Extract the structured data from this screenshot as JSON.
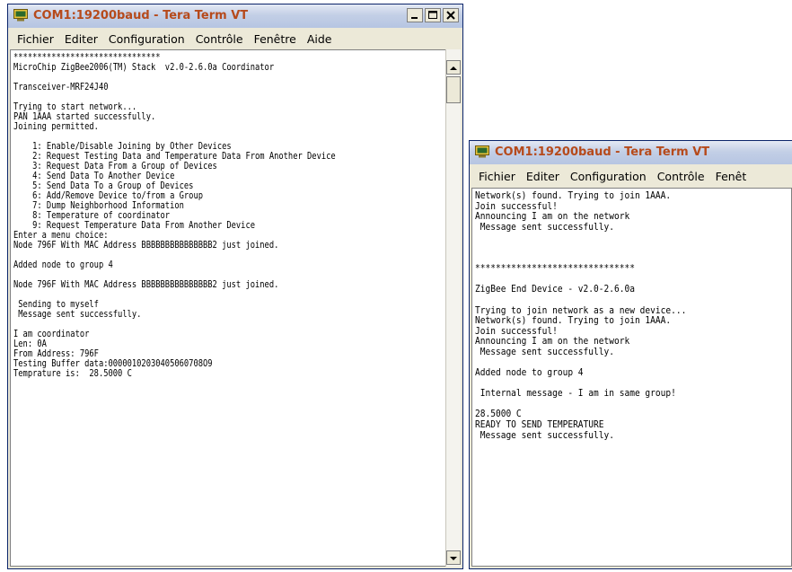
{
  "window1": {
    "title": "COM1:19200baud - Tera Term VT",
    "menu": [
      "Fichier",
      "Editer",
      "Configuration",
      "Contrôle",
      "Fenêtre",
      "Aide"
    ],
    "terminal_text": "*******************************\nMicroChip ZigBee2006(TM) Stack  v2.0-2.6.0a Coordinator\n\nTransceiver-MRF24J40\n\nTrying to start network...\nPAN 1AAA started successfully.\nJoining permitted.\n\n    1: Enable/Disable Joining by Other Devices\n    2: Request Testing Data and Temperature Data From Another Device\n    3: Request Data From a Group of Devices\n    4: Send Data To Another Device\n    5: Send Data To a Group of Devices\n    6: Add/Remove Device to/from a Group\n    7: Dump Neighborhood Information\n    8: Temperature of coordinator\n    9: Request Temperature Data From Another Device\nEnter a menu choice:\nNode 796F With MAC Address BBBBBBBBBBBBBBB2 just joined.\n\nAdded node to group 4\n\nNode 796F With MAC Address BBBBBBBBBBBBBBB2 just joined.\n\n Sending to myself\n Message sent successfully.\n\nI am coordinator\nLen: 0A\nFrom Address: 796F\nTesting Buffer data:00000102030405060708O9\nTemprature is:  28.5000 C"
  },
  "window2": {
    "title": "COM1:19200baud - Tera Term VT",
    "menu": [
      "Fichier",
      "Editer",
      "Configuration",
      "Contrôle",
      "Fenêt"
    ],
    "terminal_text": "Network(s) found. Trying to join 1AAA.\nJoin successful!\nAnnouncing I am on the network\n Message sent successfully.\n\n\n\n*******************************\n\nZigBee End Device - v2.0-2.6.0a\n\nTrying to join network as a new device...\nNetwork(s) found. Trying to join 1AAA.\nJoin successful!\nAnnouncing I am on the network\n Message sent successfully.\n\nAdded node to group 4\n\n Internal message - I am in same group!\n\n28.5000 C\nREADY TO SEND TEMPERATURE\n Message sent successfully."
  },
  "icons": {
    "app": "tera-term-icon",
    "minimize": "minimize-icon",
    "maximize": "maximize-icon",
    "close": "close-icon"
  },
  "colors": {
    "title_text": "#b64a1b",
    "titlebar": "#c3cfe6",
    "window_frame": "#ece9d8"
  }
}
